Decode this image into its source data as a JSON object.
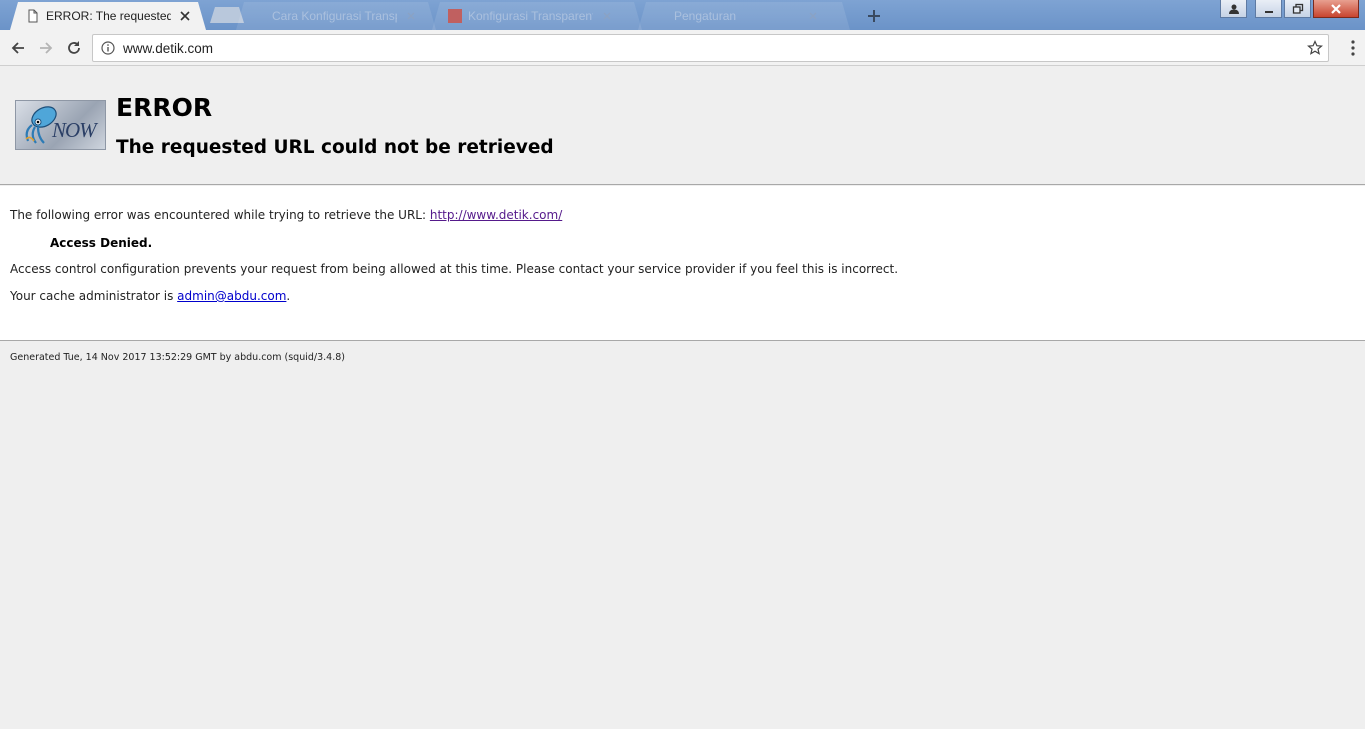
{
  "browser": {
    "tabs": [
      {
        "title": "ERROR: The requested URL could not be retrieved",
        "active": true
      },
      {
        "title": "Cara Konfigurasi Transparent",
        "active": false
      },
      {
        "title": "Konfigurasi Transparent Proxy",
        "active": false
      },
      {
        "title": "Pengaturan",
        "active": false
      }
    ],
    "address": "www.detik.com"
  },
  "page": {
    "heading": "ERROR",
    "subheading": "The requested URL could not be retrieved",
    "logo_text": "NOW",
    "intro": "The following error was encountered while trying to retrieve the URL: ",
    "url_link": "http://www.detik.com/",
    "error_title": "Access Denied.",
    "error_desc": "Access control configuration prevents your request from being allowed at this time. Please contact your service provider if you feel this is incorrect.",
    "admin_prefix": "Your cache administrator is ",
    "admin_email": "admin@abdu.com",
    "admin_suffix": ".",
    "footer": "Generated Tue, 14 Nov 2017 13:52:29 GMT by abdu.com (squid/3.4.8)"
  },
  "colors": {
    "link_visited": "#551a8b",
    "link": "#0000cc",
    "page_bg": "#efefef"
  }
}
